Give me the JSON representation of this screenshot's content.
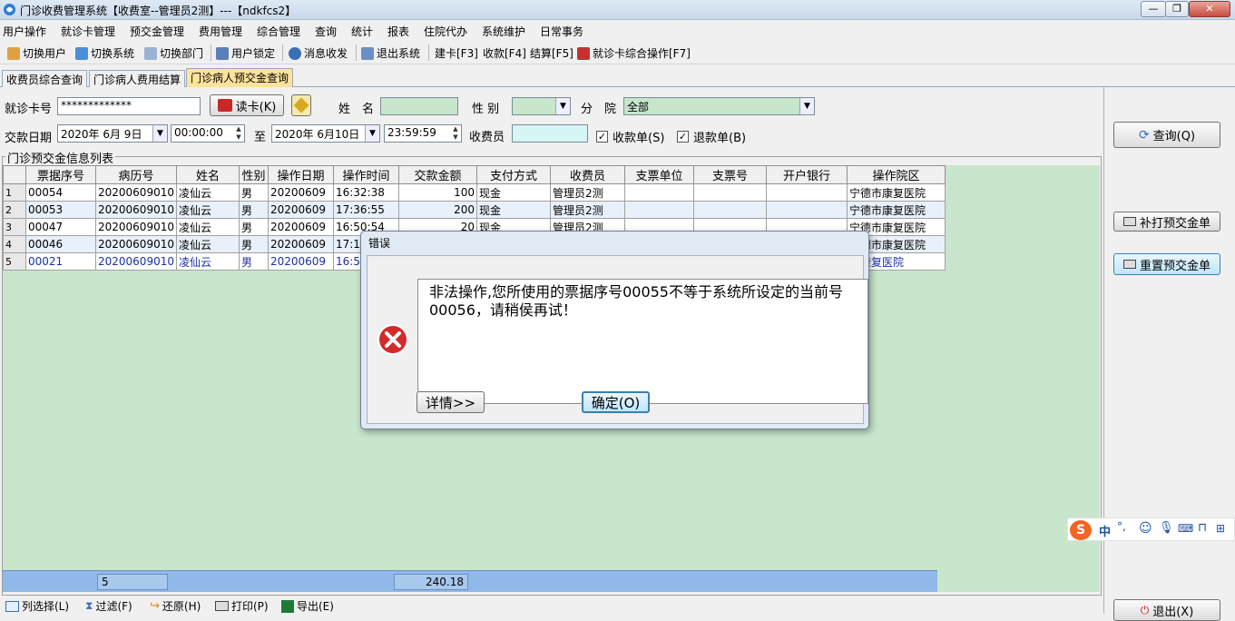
{
  "window": {
    "title": "门诊收费管理系统【收费室--管理员2测】---【ndkfcs2】",
    "buttons": {
      "minimize": "—",
      "maximize": "❐",
      "close": "✕"
    }
  },
  "menu": [
    "用户操作",
    "就诊卡管理",
    "预交金管理",
    "费用管理",
    "综合管理",
    "查询",
    "统计",
    "报表",
    "住院代办",
    "系统维护",
    "日常事务"
  ],
  "toolbar": {
    "switch_user": "切换用户",
    "switch_system": "切换系统",
    "switch_dept": "切换部门",
    "user_lock": "用户锁定",
    "message": "消息收发",
    "exit_system": "退出系统",
    "create_card": "建卡[F3]",
    "charge": "收款[F4]",
    "settle": "结算[F5]",
    "card_ops": "就诊卡综合操作[F7]"
  },
  "tabs": [
    "收费员综合查询",
    "门诊病人费用结算",
    "门诊病人预交金查询"
  ],
  "form": {
    "card_label": "就诊卡号",
    "card_value": "*************",
    "read_card": "读卡(K)",
    "name_label": "姓　名",
    "name_value": "",
    "gender_label": "性 别",
    "gender_value": "",
    "branch_label": "分　院",
    "branch_value": "全部",
    "date_label": "交款日期",
    "date_from": "2020年 6月 9日",
    "time_from": "00:00:00",
    "to_label": "至",
    "date_to": "2020年 6月10日",
    "time_to": "23:59:59",
    "cashier_label": "收费员",
    "cashier_value": "",
    "receipt_label": "收款单(S)",
    "refund_label": "退款单(B)"
  },
  "list": {
    "legend": "门诊预交金信息列表",
    "columns": [
      "票据序号",
      "病历号",
      "姓名",
      "性别",
      "操作日期",
      "操作时间",
      "交款金额",
      "支付方式",
      "收费员",
      "支票单位",
      "支票号",
      "开户银行",
      "操作院区"
    ],
    "rows": [
      {
        "n": "1",
        "cells": [
          "00054",
          "20200609010",
          "凌仙云",
          "男",
          "20200609",
          "16:32:38",
          "100",
          "现金",
          "管理员2测",
          "",
          "",
          "",
          "宁德市康复医院"
        ]
      },
      {
        "n": "2",
        "cells": [
          "00053",
          "20200609010",
          "凌仙云",
          "男",
          "20200609",
          "17:36:55",
          "200",
          "现金",
          "管理员2测",
          "",
          "",
          "",
          "宁德市康复医院"
        ]
      },
      {
        "n": "3",
        "cells": [
          "00047",
          "20200609010",
          "凌仙云",
          "男",
          "20200609",
          "16:50:54",
          "20",
          "现金",
          "管理员2测",
          "",
          "",
          "",
          "宁德市康复医院"
        ]
      },
      {
        "n": "4",
        "cells": [
          "00046",
          "20200609010",
          "凌仙云",
          "男",
          "20200609",
          "17:16",
          "",
          "",
          "",
          "",
          "",
          "",
          "宁德市康复医院"
        ]
      },
      {
        "n": "5",
        "cells": [
          "00021",
          "20200609010",
          "凌仙云",
          "男",
          "20200609",
          "16:53",
          "",
          "",
          "",
          "",
          "",
          "",
          "市康复医院"
        ]
      }
    ],
    "footer_count": "5",
    "footer_total": "240.18"
  },
  "bottom_toolbar": {
    "columns": "列选择(L)",
    "filter": "过滤(F)",
    "restore": "还原(H)",
    "print": "打印(P)",
    "export": "导出(E)"
  },
  "right_panel": {
    "query": "查询(Q)",
    "reprint": "补打预交金单",
    "reset": "重置预交金单",
    "exit": "退出(X)"
  },
  "dialog": {
    "title": "错误",
    "message": "非法操作,您所使用的票据序号00055不等于系统所设定的当前号00056，请稍侯再试！",
    "details": "详情>>",
    "ok": "确定(O)"
  },
  "ime": {
    "lang": "中",
    "punct": "°,"
  },
  "colors": {
    "grid_bg": "#c8e6cc",
    "active_tab": "#ffe39b",
    "footer": "#90b8e8",
    "selected_text": "#1a2fa8",
    "error_icon": "#d42a2a"
  }
}
